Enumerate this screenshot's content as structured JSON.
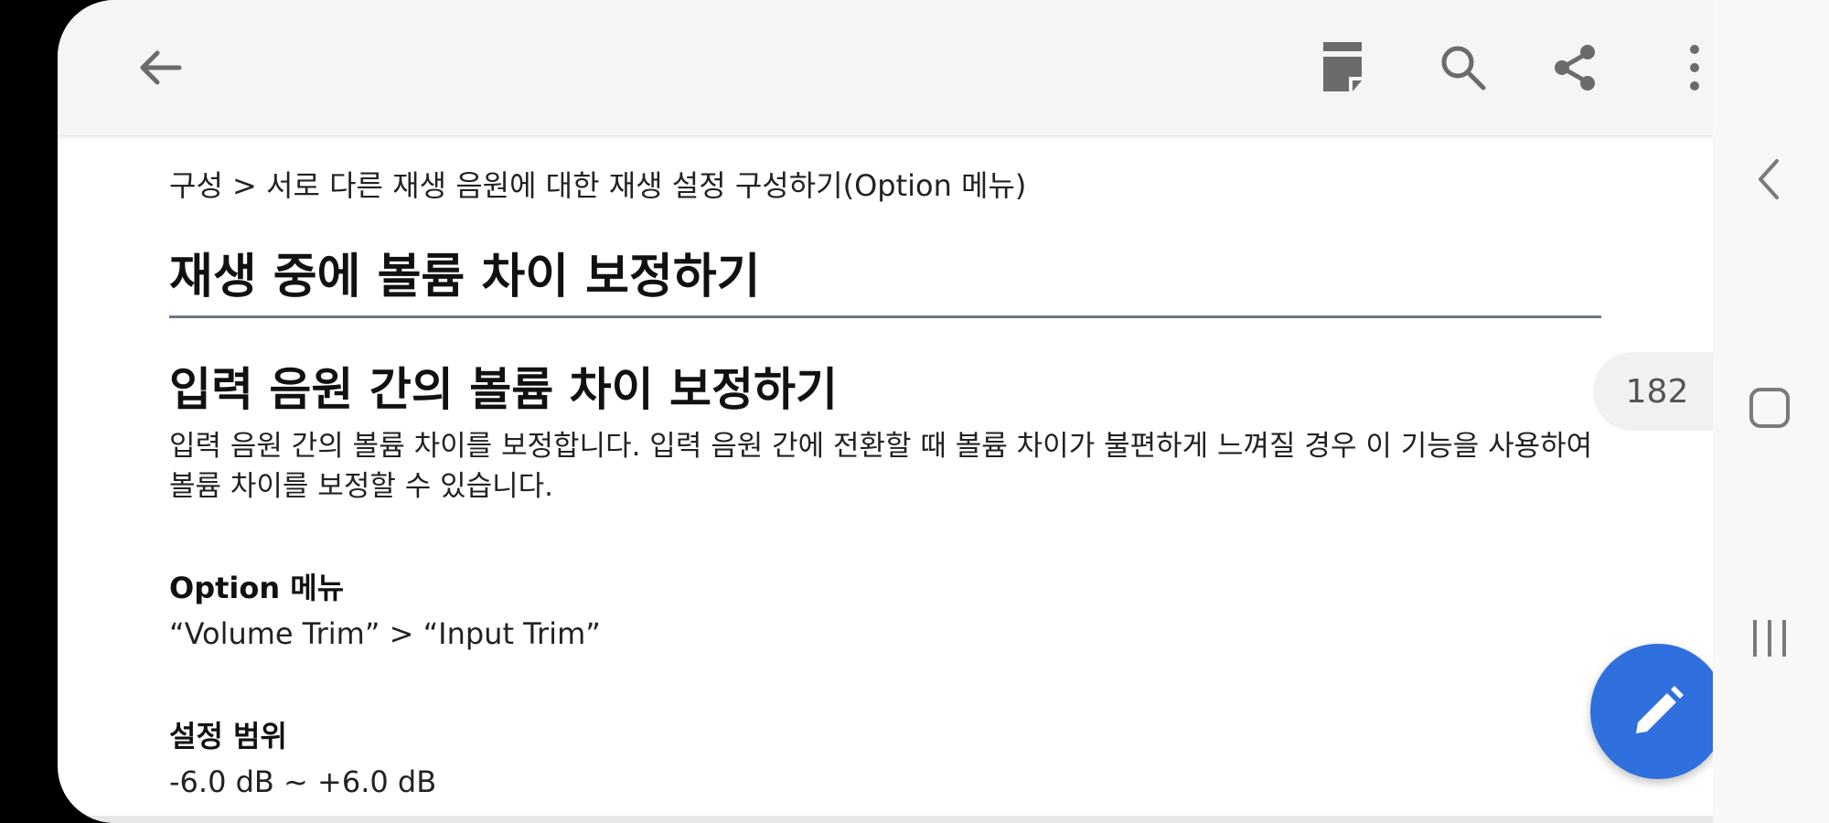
{
  "breadcrumb": "구성 > 서로 다른 재생 음원에 대한 재생 설정 구성하기(Option 메뉴)",
  "page_title": "재생 중에 볼륨 차이 보정하기",
  "section": {
    "title": "입력 음원 간의 볼륨 차이 보정하기",
    "description": "입력 음원 간의 볼륨 차이를 보정합니다. 입력 음원 간에 전환할 때 볼륨 차이가 불편하게 느껴질 경우 이 기능을 사용하여 볼륨 차이를 보정할 수 있습니다."
  },
  "option_menu": {
    "label": "Option 메뉴",
    "value": "“Volume Trim” > “Input Trim”"
  },
  "setting_range": {
    "label": "설정 범위",
    "value": "-6.0 dB ~ +6.0 dB"
  },
  "page_number": "182",
  "icons": {
    "back": "arrow-left-icon",
    "bookmark": "bookmark-icon",
    "search": "search-icon",
    "share": "share-icon",
    "more": "more-vert-icon",
    "edit": "pencil-icon",
    "nav_back": "chevron-left-icon",
    "nav_home": "rounded-square-icon",
    "nav_recents": "three-bars-icon"
  },
  "colors": {
    "fab": "#2f6fde",
    "appbar": "#f5f5f5",
    "icon": "#6b6b6b"
  }
}
